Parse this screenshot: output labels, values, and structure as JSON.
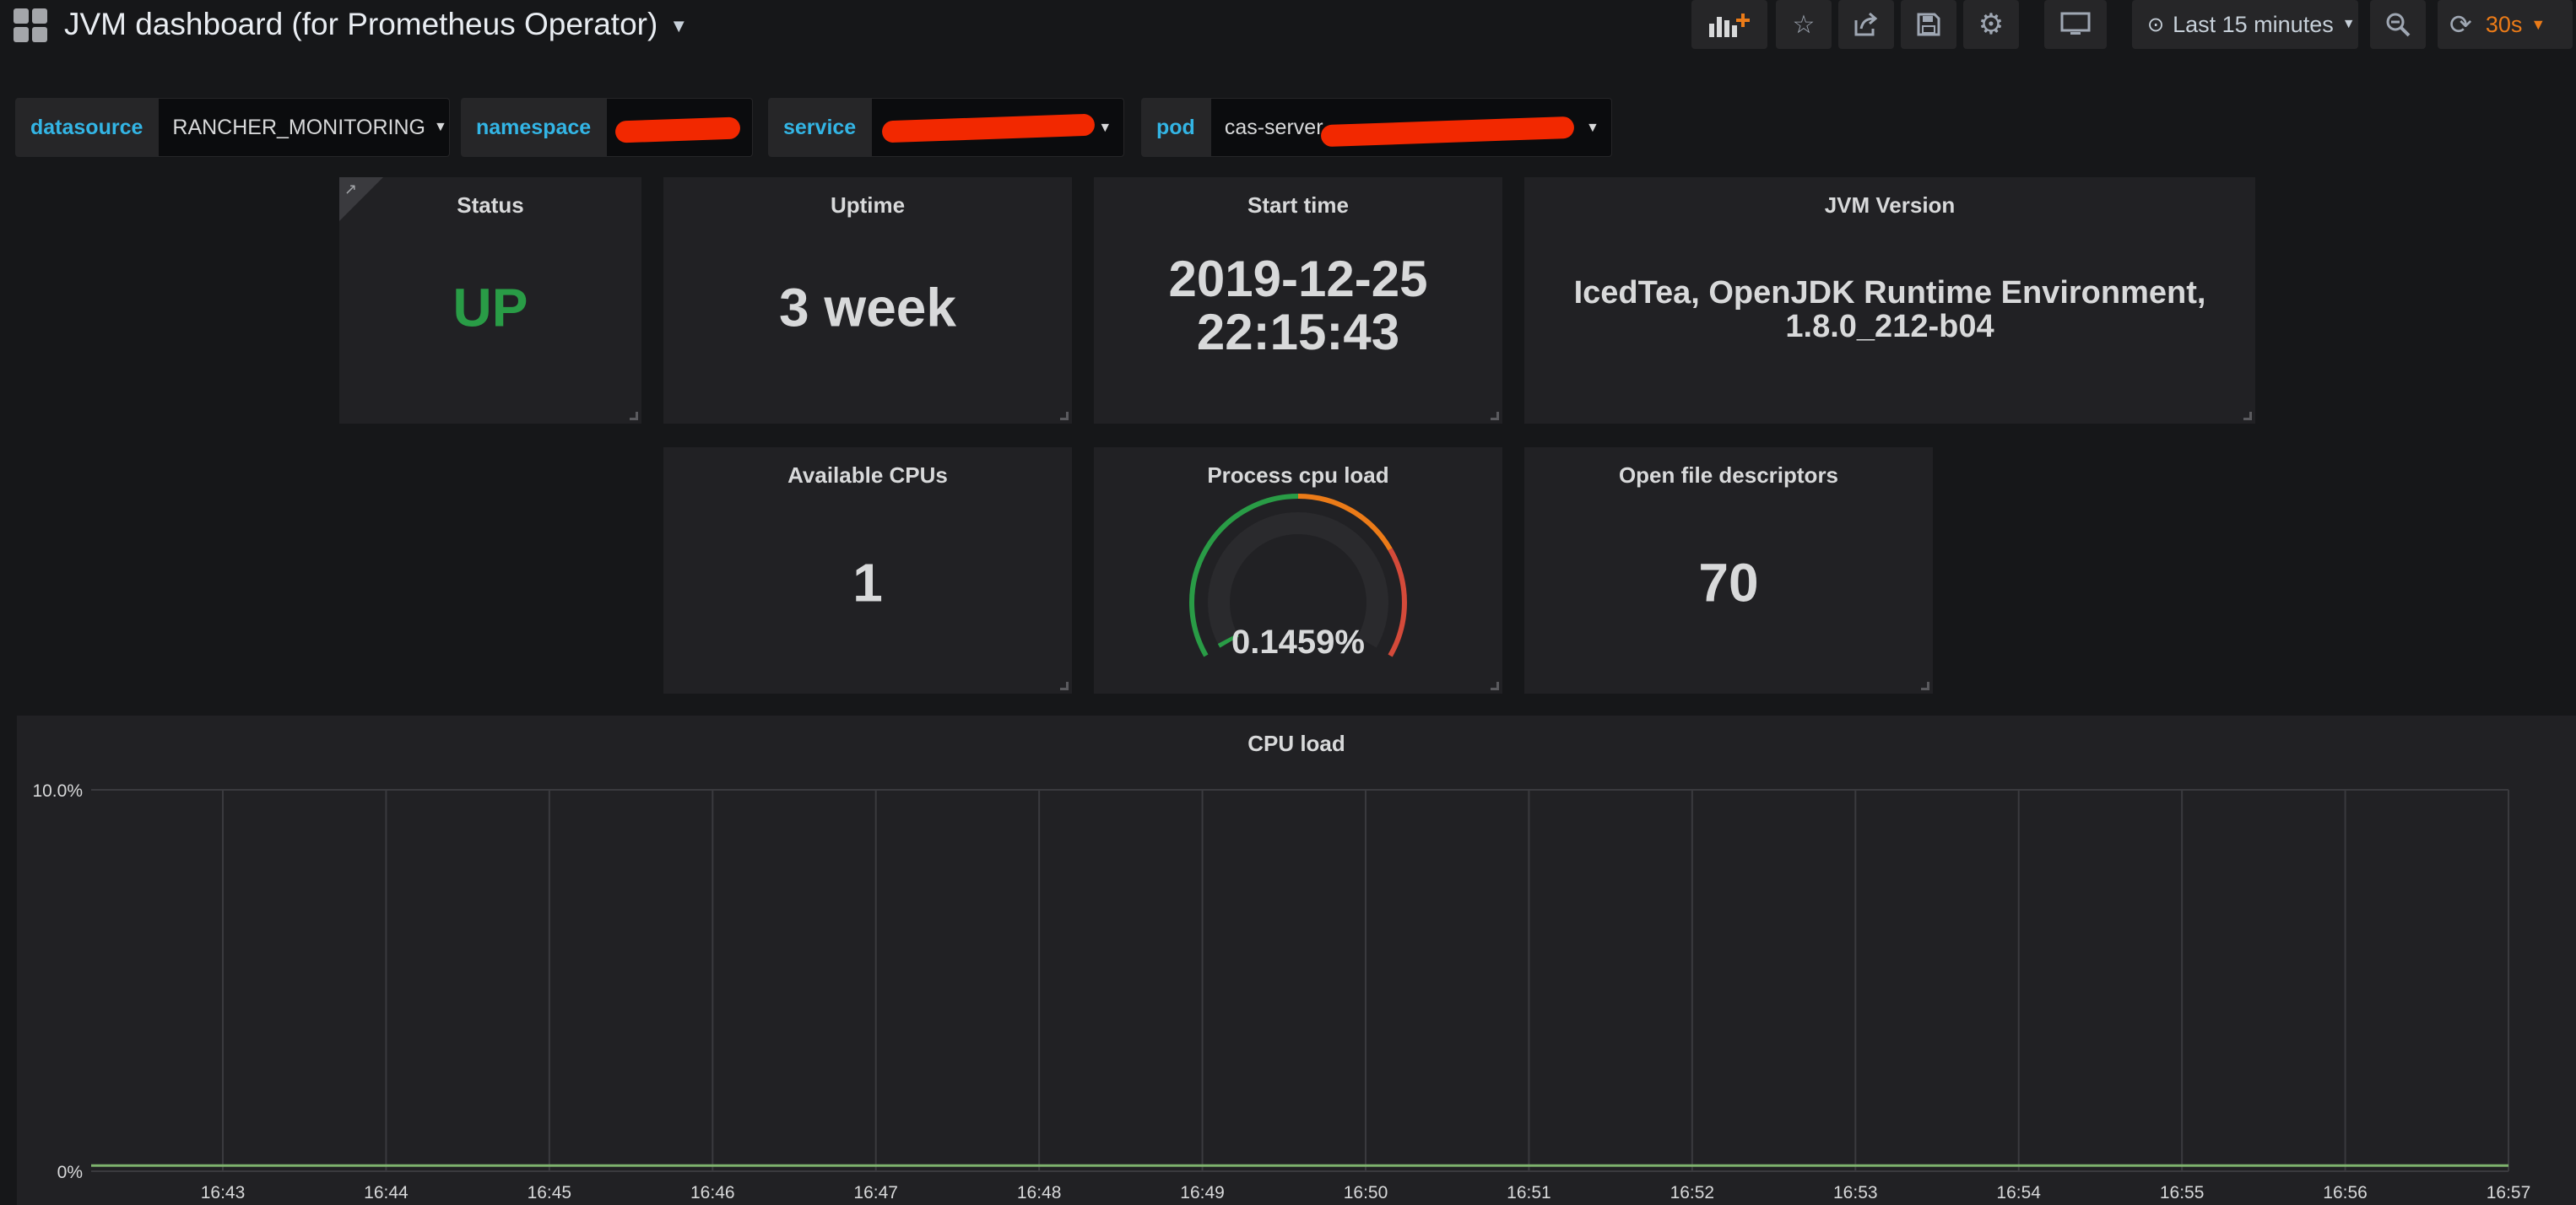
{
  "navbar": {
    "title": "JVM dashboard (for Prometheus Operator)",
    "icons": [
      "apps-icon",
      "add-panel-icon",
      "star-icon",
      "share-icon",
      "save-icon",
      "settings-icon",
      "tv-mode-icon",
      "clock-icon",
      "zoom-out-icon",
      "refresh-icon"
    ],
    "time_range": "Last 15 minutes",
    "refresh_interval": "30s"
  },
  "variables": [
    {
      "label": "datasource",
      "value": "RANCHER_MONITORING"
    },
    {
      "label": "namespace",
      "value": ""
    },
    {
      "label": "service",
      "value": ""
    },
    {
      "label": "pod",
      "value": "cas-server"
    }
  ],
  "panels": {
    "status": {
      "title": "Status",
      "value": "UP",
      "color": "#299c46"
    },
    "uptime": {
      "title": "Uptime",
      "value": "3 week"
    },
    "start_time": {
      "title": "Start time",
      "date": "2019-12-25",
      "time": "22:15:43"
    },
    "jvm_version": {
      "title": "JVM Version",
      "line1": "IcedTea, OpenJDK Runtime Environment,",
      "line2": "1.8.0_212-b04"
    },
    "available_cpus": {
      "title": "Available CPUs",
      "value": "1"
    },
    "process_cpu_load": {
      "title": "Process cpu load",
      "value": "0.1459%",
      "gauge_percent": 0.1459,
      "gauge_max": 100,
      "colors": [
        "#299c46",
        "#eb7b18",
        "#d44a3a"
      ]
    },
    "open_file_descriptors": {
      "title": "Open file descriptors",
      "value": "70"
    }
  },
  "chart_data": {
    "type": "line",
    "title": "CPU load",
    "x": [
      "16:43",
      "16:44",
      "16:45",
      "16:46",
      "16:47",
      "16:48",
      "16:49",
      "16:50",
      "16:51",
      "16:52",
      "16:53",
      "16:54",
      "16:55",
      "16:56",
      "16:57"
    ],
    "y_ticks": [
      "0%",
      "10.0%"
    ],
    "ylim": [
      0,
      10
    ],
    "series": [
      {
        "color": "#7eb26d",
        "values": [
          0.15,
          0.15,
          0.15,
          0.15,
          0.15,
          0.15,
          0.15,
          0.15,
          0.15,
          0.15,
          0.15,
          0.15,
          0.15,
          0.15,
          0.15
        ]
      }
    ],
    "grid": true
  }
}
